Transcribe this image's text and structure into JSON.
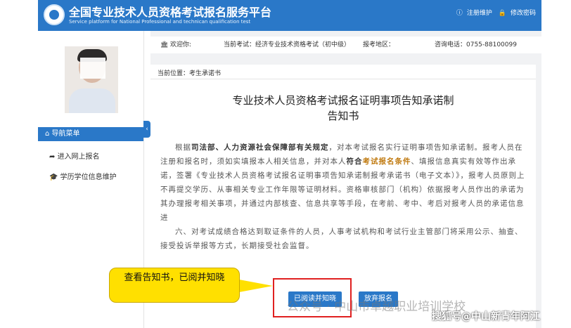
{
  "header": {
    "title": "全国专业技术人员资格考试报名服务平台",
    "subtitle": "Service platform for National Professional and technican qualification test",
    "links": [
      "注册维护",
      "修改密码"
    ]
  },
  "sidebar": {
    "nav_title": "导航菜单",
    "items": [
      {
        "label": "进入网上报名",
        "icon": "share-icon"
      },
      {
        "label": "学历学位信息维护",
        "icon": "graduation-cap-icon"
      }
    ]
  },
  "infobar": {
    "welcome": "欢迎你:",
    "current_exam": "当前考试：经济专业技术资格考试（初中级）",
    "region": "报考地区：",
    "phone": "咨询电话：0755-88100099"
  },
  "content": {
    "breadcrumb": "当前位置：考生承诺书",
    "title_line1": "专业技术人员资格考试报名证明事项告知承诺制",
    "title_line2": "告知书",
    "para1_a": "根据",
    "para1_b": "司法部、人力资源社会保障部有关规定",
    "para1_c": "，对本考试报名实行证明事项告知承诺制。报考人员在注册和报名时，须如实填报本人相关信息，并对本人",
    "para1_d": "符合",
    "para1_e": "考试报名条件",
    "para1_f": "、填报信息真实有效等作出承诺，签署《专业技术人员资格考试报名证明事项告知承诺制报考承诺书（电子文本）》，报考人员原则上不再提交学历、从事相关专业工作年限等证明材料。资格审核部门（机构）依据报考人员作出的承诺为其办理报考相关事项，并通过内部核查、信息共享等手段，在考前、考中、考后对报考人员的承诺信息进",
    "para2": "六、对考试成绩合格达到取证条件的人员，人事考试机构和考试行业主管部门将采用公示、抽查、接受投诉举报等方式，长期接受社会监督。",
    "read_button": "已阅读并知晓",
    "abandon_button": "放弃报名"
  },
  "annotation": {
    "callout": "查看告知书，已阅并知晓"
  },
  "watermark": {
    "text1": "公众号 · 中山市卓越职业培训学校",
    "text2": "搜狐号@中山新青年阿江"
  },
  "colors": {
    "brand": "#2a78c8",
    "highlight_box": "#e02020",
    "callout_bg": "#ffe000",
    "emphasis": "#c07a10"
  }
}
